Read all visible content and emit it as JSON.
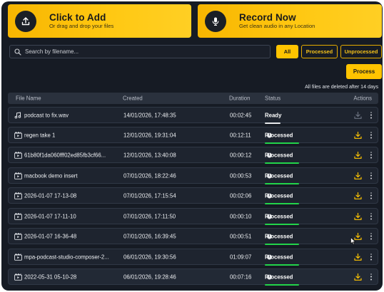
{
  "cards": {
    "add": {
      "title": "Click to Add",
      "subtitle": "Or drag and drop your files",
      "icon": "upload-icon"
    },
    "record": {
      "title": "Record Now",
      "subtitle": "Get clean audio in any Location",
      "icon": "microphone-icon"
    }
  },
  "search": {
    "placeholder": "Search by filename...",
    "value": ""
  },
  "filters": {
    "all": "All",
    "processed": "Processed",
    "unprocessed": "Unprocessed",
    "active": "All"
  },
  "process_label": "Process",
  "retention_note": "All files are deleted after 14 days",
  "table": {
    "headers": {
      "name": "File Name",
      "created": "Created",
      "duration": "Duration",
      "status": "Status",
      "actions": "Actions"
    },
    "rows": [
      {
        "name": "podcast to fix.wav",
        "created": "14/01/2026, 17:48:35",
        "duration": "00:02:45",
        "status": "Ready",
        "type": "audio",
        "download_enabled": false
      },
      {
        "name": "regen take 1",
        "created": "12/01/2026, 19:31:04",
        "duration": "00:12:11",
        "status": "Processed",
        "type": "video",
        "download_enabled": true
      },
      {
        "name": "61b80f1da060fff02ed85fb3cf66...",
        "created": "12/01/2026, 13:40:08",
        "duration": "00:00:12",
        "status": "Processed",
        "type": "video",
        "download_enabled": true
      },
      {
        "name": "macbook demo insert",
        "created": "07/01/2026, 18:22:46",
        "duration": "00:00:53",
        "status": "Processed",
        "type": "video",
        "download_enabled": true
      },
      {
        "name": "2026-01-07 17-13-08",
        "created": "07/01/2026, 17:15:54",
        "duration": "00:02:06",
        "status": "Processed",
        "type": "video",
        "download_enabled": true
      },
      {
        "name": "2026-01-07 17-11-10",
        "created": "07/01/2026, 17:11:50",
        "duration": "00:00:10",
        "status": "Processed",
        "type": "video",
        "download_enabled": true
      },
      {
        "name": "2026-01-07 16-36-48",
        "created": "07/01/2026, 16:39:45",
        "duration": "00:00:51",
        "status": "Processed",
        "type": "video",
        "download_enabled": true
      },
      {
        "name": "mpa-podcast-studio-composer-2...",
        "created": "06/01/2026, 19:30:56",
        "duration": "01:09:07",
        "status": "Processed",
        "type": "video",
        "download_enabled": true
      },
      {
        "name": "2022-05-31 05-10-28",
        "created": "06/01/2026, 19:28:46",
        "duration": "00:07:16",
        "status": "Processed",
        "type": "video",
        "download_enabled": true
      }
    ]
  },
  "colors": {
    "accent": "#ffc400",
    "background": "#161b24",
    "processed_bar": "#22d44a",
    "disabled_icon": "#6b7280"
  }
}
